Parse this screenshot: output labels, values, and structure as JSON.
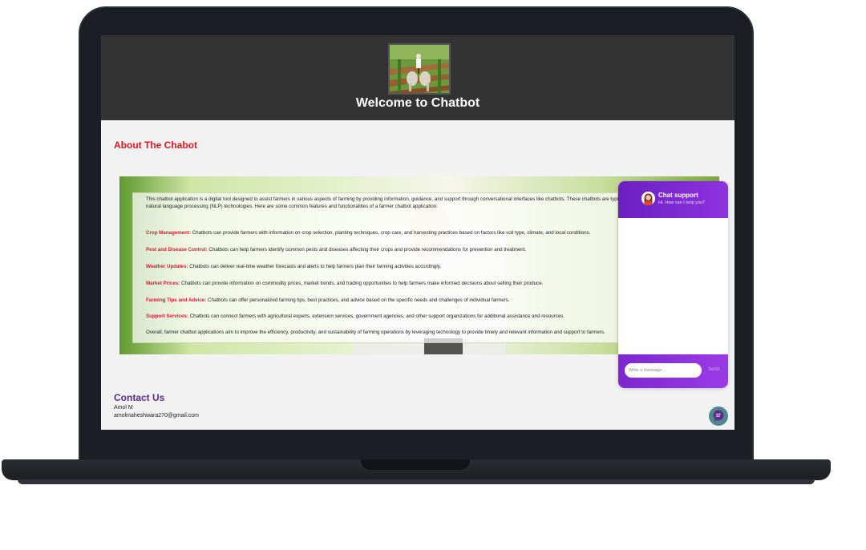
{
  "site": {
    "title": "Welcome to Chatbot"
  },
  "about": {
    "heading": "About The Chabot",
    "intro_line1": "This chatbot application is a digital tool designed to assist farmers in various aspects of farming by providing information, guidance, and support through conversational interfaces like chatbots. These chatbots are typically",
    "intro_line2": "natural language processing (NLP) technologies. Here are some common features and functionalities of a farmer chatbot application:",
    "features": [
      {
        "title": "Crop Management:",
        "text": "Chatbots can provide farmers with information on crop selection, planting techniques, crop care, and harvesting practices based on factors like soil type, climate, and local conditions."
      },
      {
        "title": "Pest and Disease Control:",
        "text": "Chatbots can help farmers identify common pests and diseases affecting their crops and provide recommendations for prevention and treatment."
      },
      {
        "title": "Weather Updates:",
        "text": "Chatbots can deliver real-time weather forecasts and alerts to help farmers plan their farming activities accordingly."
      },
      {
        "title": "Market Prices:",
        "text": "Chatbots can provide information on commodity prices, market trends, and trading opportunities to help farmers make informed decisions about selling their produce."
      },
      {
        "title": "Farming Tips and Advice:",
        "text": "Chatbots can offer personalized farming tips, best practices, and advice based on the specific needs and challenges of individual farmers."
      },
      {
        "title": "Support Services:",
        "text": "Chatbots can connect farmers with agricultural experts, extension services, government agencies, and other support organizations for additional assistance and resources."
      }
    ],
    "conclusion": "Overall, farmer chatbot applications aim to improve the efficiency, productivity, and sustainability of farming operations by leveraging technology to provide timely and relevant information and support to farmers."
  },
  "chat": {
    "title": "Chat support",
    "subtitle": "Hi. How can I help you?",
    "input_placeholder": "Write a message...",
    "send_label": "Send"
  },
  "contact": {
    "heading": "Contact Us",
    "name": "Amol M",
    "email": "amolmaheshwara270@gmail.com"
  },
  "colors": {
    "header_bg": "#333333",
    "about_heading": "#e0151f",
    "feature_title": "#d31a36",
    "chat_accent": "#7c27d0",
    "contact_heading": "#5b2c8e"
  }
}
